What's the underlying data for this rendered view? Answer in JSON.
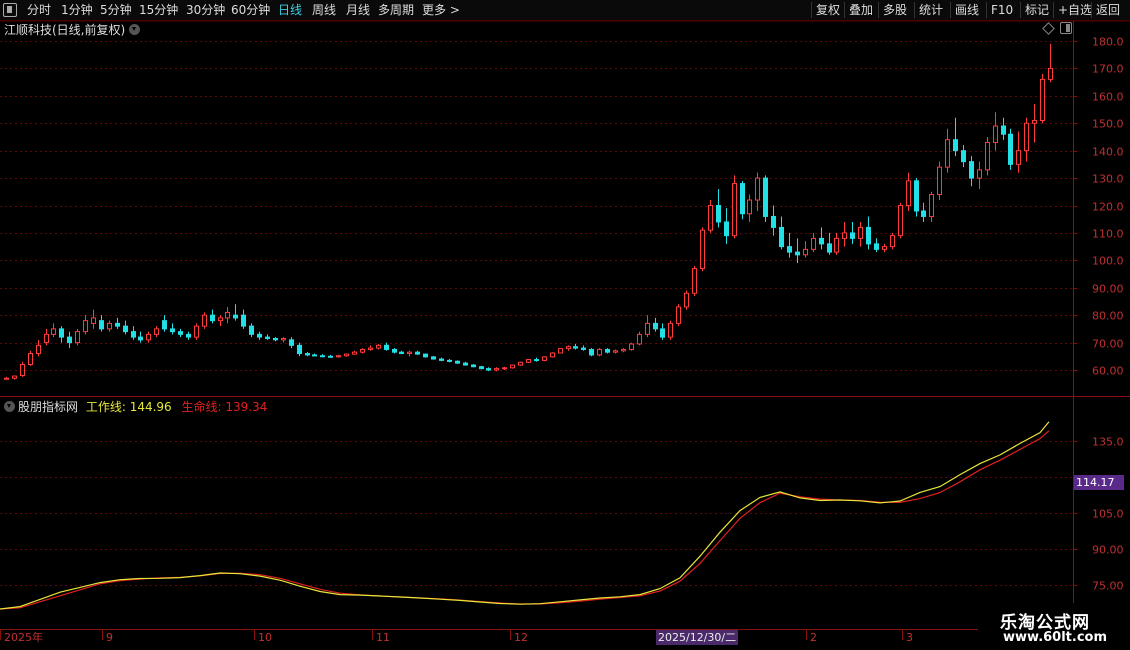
{
  "toolbar": {
    "left_items": [
      "分时",
      "1分钟",
      "5分钟",
      "15分钟",
      "30分钟",
      "60分钟",
      "日线",
      "周线",
      "月线",
      "多周期",
      "更多 >"
    ],
    "active": "日线",
    "right_items": [
      "复权",
      "叠加",
      "多股",
      "统计",
      "画线",
      "F10",
      "标记",
      "+自选",
      "返回"
    ]
  },
  "stock": {
    "title": "江顺科技(日线,前复权)"
  },
  "indicator": {
    "name": "股朋指标网",
    "work_label": "工作线: 144.96",
    "life_label": "生命线: 139.34",
    "work_color": "#e6e63a",
    "life_color": "#e02020"
  },
  "price_axis": [
    "180.0",
    "170.0",
    "160.0",
    "150.0",
    "140.0",
    "130.0",
    "120.0",
    "110.0",
    "100.0",
    "90.00",
    "80.00",
    "70.00",
    "60.00"
  ],
  "ind_axis": [
    "135.0",
    "105.0",
    "90.00",
    "75.00"
  ],
  "ind_badge": "114.17",
  "x_axis": [
    {
      "label": "2025年",
      "pos": 4
    },
    {
      "label": "9",
      "pos": 106
    },
    {
      "label": "10",
      "pos": 258
    },
    {
      "label": "11",
      "pos": 376
    },
    {
      "label": "12",
      "pos": 514
    },
    {
      "label": "2",
      "pos": 810
    },
    {
      "label": "3",
      "pos": 906
    }
  ],
  "cursor_date": "2025/12/30/二",
  "watermark": {
    "line1": "乐淘公式网",
    "line2": "www.60lt.com"
  },
  "chart_data": {
    "type": "candlestick",
    "colors": {
      "up": "#ff3c3c",
      "down": "#22e0e6"
    },
    "price_ylim": [
      55,
      185
    ],
    "candles": [
      [
        57,
        57.5,
        56.5,
        57
      ],
      [
        57,
        58,
        56.5,
        57.8
      ],
      [
        58,
        63,
        57.5,
        62
      ],
      [
        62,
        67,
        61.5,
        66
      ],
      [
        66,
        71,
        65,
        69
      ],
      [
        70,
        75,
        69,
        73
      ],
      [
        73,
        77,
        72,
        75
      ],
      [
        75,
        76,
        70,
        72
      ],
      [
        72,
        74,
        68,
        70
      ],
      [
        70,
        75,
        69,
        74
      ],
      [
        74,
        80,
        73,
        78
      ],
      [
        77,
        82,
        75,
        79
      ],
      [
        78,
        80,
        74,
        75
      ],
      [
        75,
        78,
        74,
        77
      ],
      [
        77,
        79,
        75,
        76
      ],
      [
        76,
        78,
        73,
        74
      ],
      [
        74,
        76,
        71,
        72
      ],
      [
        72,
        74,
        70,
        71
      ],
      [
        71,
        74,
        70,
        73
      ],
      [
        73,
        76,
        72,
        75
      ],
      [
        78,
        80,
        74,
        75
      ],
      [
        75,
        77,
        73,
        74
      ],
      [
        74,
        75,
        72,
        73
      ],
      [
        73,
        74,
        71,
        72
      ],
      [
        72,
        77,
        71,
        76
      ],
      [
        76,
        81,
        75,
        80
      ],
      [
        80,
        82,
        77,
        78
      ],
      [
        78,
        80,
        76,
        79
      ],
      [
        79,
        83,
        77,
        81
      ],
      [
        80,
        84,
        78,
        79
      ],
      [
        80,
        82,
        75,
        76
      ],
      [
        76,
        77,
        72,
        73
      ],
      [
        73,
        74,
        71,
        72
      ],
      [
        72,
        73,
        71,
        71.5
      ],
      [
        71.5,
        72,
        70.5,
        71
      ],
      [
        71,
        72,
        70,
        71.5
      ],
      [
        71,
        72,
        68,
        69
      ],
      [
        69,
        70,
        65,
        66
      ],
      [
        66,
        66.5,
        65,
        65.5
      ],
      [
        65.5,
        66,
        65,
        65.2
      ],
      [
        65.2,
        65.8,
        64.8,
        65
      ],
      [
        65,
        65.5,
        64.5,
        64.8
      ],
      [
        64.8,
        65.5,
        64.5,
        65.2
      ],
      [
        65.2,
        66,
        64.8,
        65.8
      ],
      [
        65.8,
        67,
        65.5,
        66.5
      ],
      [
        66.5,
        68,
        66,
        67.5
      ],
      [
        67.5,
        69,
        67,
        68
      ],
      [
        68,
        69.5,
        67.5,
        69
      ],
      [
        69,
        70,
        67,
        67.5
      ],
      [
        67.5,
        68,
        66,
        66.5
      ],
      [
        66.5,
        67,
        65.8,
        66
      ],
      [
        66,
        67,
        65,
        66.5
      ],
      [
        66.5,
        67,
        65.5,
        65.8
      ],
      [
        65.8,
        66,
        64.5,
        64.8
      ],
      [
        64.8,
        65,
        63.8,
        64
      ],
      [
        64,
        64.5,
        63.2,
        63.5
      ],
      [
        63.5,
        64,
        62.8,
        63.2
      ],
      [
        63.2,
        63.5,
        62.2,
        62.5
      ],
      [
        62.5,
        63,
        61.6,
        61.8
      ],
      [
        61.8,
        62.2,
        61,
        61.2
      ],
      [
        61.2,
        61.5,
        60.3,
        60.5
      ],
      [
        60.5,
        61,
        59.6,
        60
      ],
      [
        60,
        61,
        59.5,
        60.5
      ],
      [
        60.5,
        61.2,
        60,
        60.8
      ],
      [
        60.8,
        62,
        60.5,
        61.8
      ],
      [
        61.8,
        63,
        61.5,
        62.8
      ],
      [
        62.8,
        64,
        62.5,
        63.8
      ],
      [
        63.8,
        64.5,
        63,
        63.5
      ],
      [
        63.5,
        65,
        63.2,
        64.8
      ],
      [
        64.8,
        66.5,
        64.5,
        66.2
      ],
      [
        66.2,
        68,
        66,
        67.8
      ],
      [
        67.8,
        69,
        67,
        68.5
      ],
      [
        68.5,
        69.5,
        67.5,
        68
      ],
      [
        68,
        69,
        67,
        67.5
      ],
      [
        67.5,
        68,
        65,
        65.5
      ],
      [
        65.5,
        68,
        65,
        67.5
      ],
      [
        67.5,
        68,
        66,
        66.5
      ],
      [
        66.5,
        67.5,
        66,
        67
      ],
      [
        67,
        68,
        66.5,
        67.5
      ],
      [
        67.5,
        70,
        67,
        69.5
      ],
      [
        69.5,
        74,
        69,
        73
      ],
      [
        73,
        80,
        72,
        77
      ],
      [
        77,
        79,
        74,
        75
      ],
      [
        75,
        77,
        71,
        72
      ],
      [
        72,
        78,
        71,
        77
      ],
      [
        77,
        84,
        76,
        83
      ],
      [
        83,
        89,
        82,
        88
      ],
      [
        88,
        98,
        87,
        97
      ],
      [
        97,
        112,
        96,
        111
      ],
      [
        111,
        122,
        110,
        120
      ],
      [
        120,
        126,
        112,
        114
      ],
      [
        114,
        119,
        106,
        109
      ],
      [
        109,
        131,
        108,
        128
      ],
      [
        128,
        129,
        115,
        117
      ],
      [
        117,
        124,
        114,
        122
      ],
      [
        122,
        132,
        118,
        130
      ],
      [
        130,
        131,
        114,
        116
      ],
      [
        116,
        120,
        109,
        112
      ],
      [
        112,
        116,
        104,
        105
      ],
      [
        105,
        110,
        101,
        103
      ],
      [
        103,
        108,
        99,
        102
      ],
      [
        102,
        107,
        101,
        104
      ],
      [
        104,
        110,
        103,
        108
      ],
      [
        108,
        112,
        104,
        106
      ],
      [
        106,
        110,
        102,
        103
      ],
      [
        103,
        110,
        102,
        108
      ],
      [
        108,
        114,
        105,
        110
      ],
      [
        110,
        114,
        106,
        108
      ],
      [
        108,
        114,
        105,
        112
      ],
      [
        112,
        116,
        104,
        106
      ],
      [
        106,
        108,
        103,
        104
      ],
      [
        104,
        106,
        103,
        105
      ],
      [
        105,
        110,
        104,
        109
      ],
      [
        109,
        121,
        108,
        120
      ],
      [
        120,
        132,
        118,
        129
      ],
      [
        129,
        130,
        116,
        118
      ],
      [
        118,
        121,
        114,
        116
      ],
      [
        116,
        125,
        114,
        124
      ],
      [
        124,
        136,
        122,
        134
      ],
      [
        134,
        148,
        132,
        144
      ],
      [
        144,
        152,
        138,
        140
      ],
      [
        140,
        142,
        134,
        136
      ],
      [
        136,
        138,
        127,
        130
      ],
      [
        130,
        136,
        126,
        133
      ],
      [
        133,
        145,
        131,
        143
      ],
      [
        143,
        154,
        140,
        149
      ],
      [
        149,
        152,
        144,
        146
      ],
      [
        146,
        148,
        133,
        135
      ],
      [
        135,
        147,
        132,
        140
      ],
      [
        140,
        152,
        136,
        150
      ],
      [
        150,
        157,
        143,
        151
      ],
      [
        151,
        168,
        150,
        166
      ],
      [
        166,
        179,
        165,
        170
      ]
    ],
    "indicator_ylim": [
      65,
      150
    ],
    "work_line": [
      [
        0,
        65
      ],
      [
        20,
        66
      ],
      [
        40,
        69
      ],
      [
        60,
        72
      ],
      [
        80,
        74
      ],
      [
        100,
        76
      ],
      [
        120,
        77.2
      ],
      [
        140,
        77.7
      ],
      [
        160,
        77.8
      ],
      [
        180,
        78.1
      ],
      [
        200,
        78.9
      ],
      [
        220,
        80
      ],
      [
        240,
        79.7
      ],
      [
        260,
        78.7
      ],
      [
        280,
        77
      ],
      [
        300,
        74.5
      ],
      [
        320,
        72.3
      ],
      [
        340,
        71
      ],
      [
        360,
        70.8
      ],
      [
        380,
        70.4
      ],
      [
        400,
        70
      ],
      [
        420,
        69.6
      ],
      [
        440,
        69.1
      ],
      [
        460,
        68.6
      ],
      [
        480,
        67.9
      ],
      [
        500,
        67.3
      ],
      [
        520,
        67
      ],
      [
        540,
        67.2
      ],
      [
        560,
        68
      ],
      [
        580,
        68.8
      ],
      [
        600,
        69.6
      ],
      [
        620,
        70.1
      ],
      [
        640,
        71
      ],
      [
        660,
        73.5
      ],
      [
        680,
        78
      ],
      [
        700,
        87
      ],
      [
        720,
        97
      ],
      [
        740,
        106
      ],
      [
        760,
        111.5
      ],
      [
        780,
        113.8
      ],
      [
        800,
        111.3
      ],
      [
        820,
        110.2
      ],
      [
        840,
        110.4
      ],
      [
        860,
        110.1
      ],
      [
        880,
        109.2
      ],
      [
        900,
        110
      ],
      [
        920,
        113.6
      ],
      [
        940,
        116
      ],
      [
        960,
        121
      ],
      [
        980,
        125.6
      ],
      [
        1000,
        129.2
      ],
      [
        1020,
        134
      ],
      [
        1040,
        138.5
      ],
      [
        1049,
        143
      ]
    ],
    "life_line": [
      [
        0,
        65
      ],
      [
        20,
        65.5
      ],
      [
        40,
        68
      ],
      [
        60,
        70.5
      ],
      [
        80,
        73
      ],
      [
        100,
        75.5
      ],
      [
        120,
        76.8
      ],
      [
        140,
        77.5
      ],
      [
        160,
        78
      ],
      [
        180,
        78.2
      ],
      [
        200,
        78.8
      ],
      [
        220,
        79.8
      ],
      [
        240,
        79.9
      ],
      [
        260,
        79.3
      ],
      [
        280,
        77.8
      ],
      [
        300,
        75.5
      ],
      [
        320,
        73.2
      ],
      [
        340,
        71.6
      ],
      [
        360,
        70.9
      ],
      [
        380,
        70.4
      ],
      [
        400,
        70.1
      ],
      [
        420,
        69.6
      ],
      [
        440,
        69.2
      ],
      [
        460,
        68.7
      ],
      [
        480,
        68.1
      ],
      [
        500,
        67.5
      ],
      [
        520,
        67.1
      ],
      [
        540,
        67.1
      ],
      [
        560,
        67.6
      ],
      [
        580,
        68.3
      ],
      [
        600,
        69.1
      ],
      [
        620,
        69.8
      ],
      [
        640,
        70.5
      ],
      [
        660,
        72.5
      ],
      [
        680,
        76.6
      ],
      [
        700,
        84
      ],
      [
        720,
        93.5
      ],
      [
        740,
        102.8
      ],
      [
        760,
        109.3
      ],
      [
        780,
        113.3
      ],
      [
        800,
        111.7
      ],
      [
        820,
        110.8
      ],
      [
        840,
        110.4
      ],
      [
        860,
        110.2
      ],
      [
        880,
        109.5
      ],
      [
        900,
        109.4
      ],
      [
        920,
        111
      ],
      [
        940,
        113.5
      ],
      [
        960,
        118
      ],
      [
        980,
        123
      ],
      [
        1000,
        127
      ],
      [
        1020,
        131.5
      ],
      [
        1040,
        136
      ],
      [
        1049,
        139.3
      ]
    ]
  }
}
